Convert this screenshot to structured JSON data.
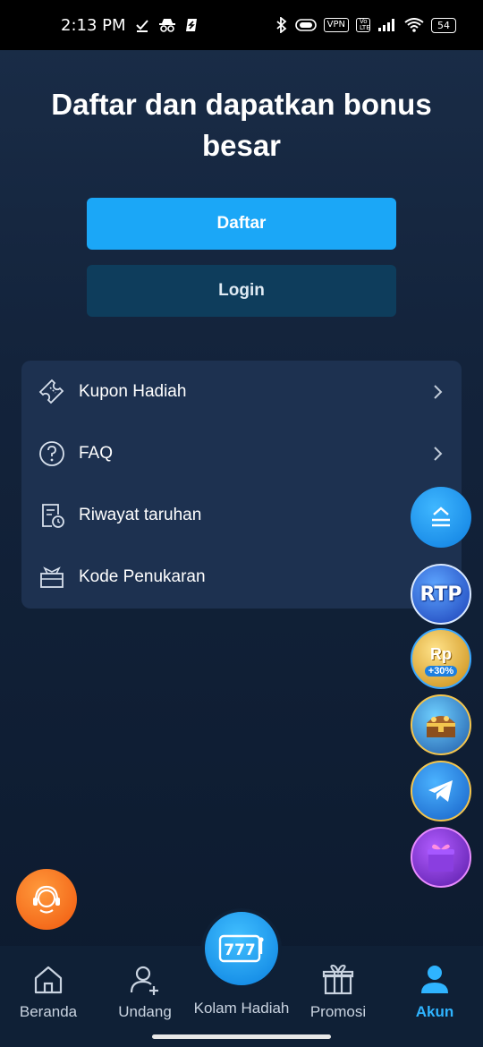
{
  "status_bar": {
    "time": "2:13 PM",
    "vpn": "VPN",
    "volte": "Vo LTE",
    "battery": "54"
  },
  "header": {
    "headline": "Daftar dan dapatkan bonus besar"
  },
  "auth": {
    "register_label": "Daftar",
    "login_label": "Login"
  },
  "menu": {
    "items": [
      {
        "label": "Kupon Hadiah",
        "icon": "ticket-icon"
      },
      {
        "label": "FAQ",
        "icon": "question-icon"
      },
      {
        "label": "Riwayat taruhan",
        "icon": "history-icon"
      },
      {
        "label": "Kode Penukaran",
        "icon": "gift-box-icon"
      }
    ]
  },
  "floating": {
    "rtp_label": "RTP",
    "rp_label": "Rp",
    "bonus_label": "+30%"
  },
  "tabbar": {
    "items": [
      {
        "label": "Beranda",
        "icon": "home-icon"
      },
      {
        "label": "Undang",
        "icon": "add-user-icon"
      },
      {
        "label": "Kolam Hadiah",
        "icon": "slot-777-icon"
      },
      {
        "label": "Promosi",
        "icon": "gift-icon"
      },
      {
        "label": "Akun",
        "icon": "user-icon"
      }
    ],
    "active": "Akun"
  },
  "colors": {
    "accent": "#1ba7f7",
    "login_bg": "#0e3d5c",
    "card_bg": "#1d3150",
    "active_tab": "#2fb4ff",
    "support": "#f0580e"
  }
}
